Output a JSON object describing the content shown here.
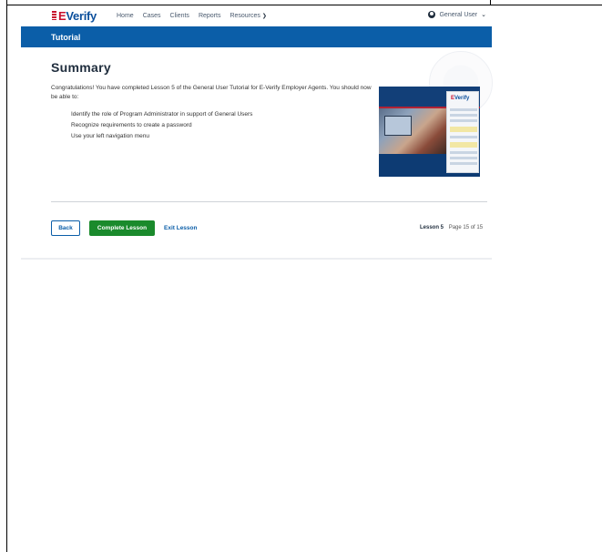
{
  "brand": {
    "logo_e": "E",
    "logo_verify": "Verify"
  },
  "nav": {
    "items": [
      {
        "label": "Home"
      },
      {
        "label": "Cases"
      },
      {
        "label": "Clients"
      },
      {
        "label": "Reports"
      },
      {
        "label": "Resources"
      }
    ],
    "user": "General User"
  },
  "banner": {
    "title": "Tutorial"
  },
  "page": {
    "title": "Summary",
    "intro": "Congratulations! You have completed Lesson 5 of the General User Tutorial for E-Verify Employer Agents. You should now be able to:",
    "bullets": [
      "Identify the role of Program Administrator in support of General Users",
      "Recognize requirements to create a password",
      "Use your left navigation menu"
    ]
  },
  "illustration": {
    "logo_e": "E",
    "logo_verify": "Verify"
  },
  "actions": {
    "back": "Back",
    "complete": "Complete Lesson",
    "exit": "Exit Lesson"
  },
  "progress": {
    "lesson": "Lesson 5",
    "page": "Page 15 of 15"
  },
  "colors": {
    "brand_blue": "#0b5ea8",
    "brand_red": "#c8102e",
    "success_green": "#1a8a2c"
  },
  "icons": [
    "user-circle-icon",
    "chevron-down-icon"
  ]
}
